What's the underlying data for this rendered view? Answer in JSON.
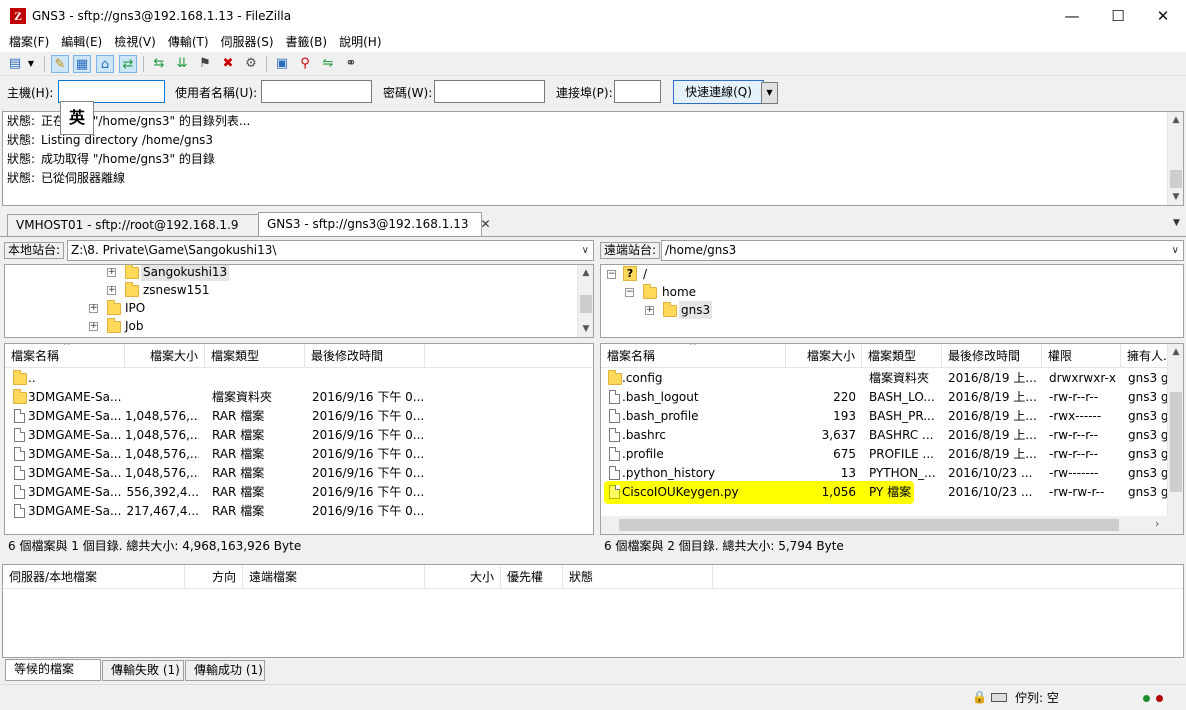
{
  "window": {
    "logo": "Z",
    "title": "GNS3 - sftp://gns3@192.168.1.13 - FileZilla",
    "minimize": "—",
    "maximize": "☐",
    "close": "✕"
  },
  "menu": [
    "檔案(F)",
    "編輯(E)",
    "檢視(V)",
    "傳輸(T)",
    "伺服器(S)",
    "書籤(B)",
    "說明(H)"
  ],
  "toolbar_icons": [
    "site-manager-icon",
    "dropdown-icon",
    "message-log-icon",
    "local-tree-icon",
    "remote-tree-icon",
    "transfer-queue-icon",
    "refresh-icon",
    "process-queue-icon",
    "cancel-icon",
    "disconnect-icon",
    "reconnect-icon",
    "filter-icon",
    "compare-icon",
    "sync-browse-icon",
    "search-icon"
  ],
  "quickconnect": {
    "host_label": "主機(H):",
    "user_label": "使用者名稱(U):",
    "pass_label": "密碼(W):",
    "port_label": "連接埠(P):",
    "button": "快速連線(Q)",
    "host_value": "",
    "user_value": "",
    "pass_value": "",
    "port_value": ""
  },
  "ime": "英",
  "log": [
    {
      "label": "狀態:",
      "text": "正在讀取 \"/home/gns3\" 的目錄列表..."
    },
    {
      "label": "狀態:",
      "text": "Listing directory /home/gns3"
    },
    {
      "label": "狀態:",
      "text": "成功取得 \"/home/gns3\" 的目錄"
    },
    {
      "label": "狀態:",
      "text": "已從伺服器離線"
    }
  ],
  "tabs": [
    {
      "label": "VMHOST01 - sftp://root@192.168.1.9",
      "active": false
    },
    {
      "label": "GNS3 - sftp://gns3@192.168.1.13",
      "active": true,
      "close": "✕"
    }
  ],
  "local": {
    "site_label": "本地站台:",
    "path": "Z:\\8. Private\\Game\\Sangokushi13\\",
    "tree": [
      {
        "label": "Sangokushi13",
        "selected": true
      },
      {
        "label": "zsnesw151",
        "selected": false
      },
      {
        "label": "IPO",
        "selected": false
      },
      {
        "label": "Job",
        "selected": false
      }
    ],
    "columns": [
      "檔案名稱",
      "檔案大小",
      "檔案類型",
      "最後修改時間"
    ],
    "rows": [
      {
        "name": "..",
        "size": "",
        "type": "",
        "modified": "",
        "icon": "folder"
      },
      {
        "name": "3DMGAME-Sa...",
        "size": "",
        "type": "檔案資料夾",
        "modified": "2016/9/16 下午 0...",
        "icon": "folder"
      },
      {
        "name": "3DMGAME-Sa...",
        "size": "1,048,576,...",
        "type": "RAR 檔案",
        "modified": "2016/9/16 下午 0...",
        "icon": "file"
      },
      {
        "name": "3DMGAME-Sa...",
        "size": "1,048,576,...",
        "type": "RAR 檔案",
        "modified": "2016/9/16 下午 0...",
        "icon": "file"
      },
      {
        "name": "3DMGAME-Sa...",
        "size": "1,048,576,...",
        "type": "RAR 檔案",
        "modified": "2016/9/16 下午 0...",
        "icon": "file"
      },
      {
        "name": "3DMGAME-Sa...",
        "size": "1,048,576,...",
        "type": "RAR 檔案",
        "modified": "2016/9/16 下午 0...",
        "icon": "file"
      },
      {
        "name": "3DMGAME-Sa...",
        "size": "556,392,4...",
        "type": "RAR 檔案",
        "modified": "2016/9/16 下午 0...",
        "icon": "file"
      },
      {
        "name": "3DMGAME-Sa...",
        "size": "217,467,4...",
        "type": "RAR 檔案",
        "modified": "2016/9/16 下午 0...",
        "icon": "file"
      }
    ],
    "status": "6 個檔案與 1 個目錄. 總共大小: 4,968,163,926 Byte"
  },
  "remote": {
    "site_label": "遠端站台:",
    "path": "/home/gns3",
    "tree": [
      {
        "label": "/",
        "marker": "?"
      },
      {
        "label": "home"
      },
      {
        "label": "gns3",
        "selected": true
      }
    ],
    "columns": [
      "檔案名稱",
      "檔案大小",
      "檔案類型",
      "最後修改時間",
      "權限",
      "擁有人..."
    ],
    "rows": [
      {
        "name": ".config",
        "size": "",
        "type": "檔案資料夾",
        "modified": "2016/8/19 上...",
        "perm": "drwxrwxr-x",
        "owner": "gns3 g",
        "icon": "folder",
        "highlight": false
      },
      {
        "name": ".bash_logout",
        "size": "220",
        "type": "BASH_LO...",
        "modified": "2016/8/19 上...",
        "perm": "-rw-r--r--",
        "owner": "gns3 g",
        "icon": "file",
        "highlight": false
      },
      {
        "name": ".bash_profile",
        "size": "193",
        "type": "BASH_PR...",
        "modified": "2016/8/19 上...",
        "perm": "-rwx------",
        "owner": "gns3 g",
        "icon": "file",
        "highlight": false
      },
      {
        "name": ".bashrc",
        "size": "3,637",
        "type": "BASHRC ...",
        "modified": "2016/8/19 上...",
        "perm": "-rw-r--r--",
        "owner": "gns3 g",
        "icon": "file",
        "highlight": false
      },
      {
        "name": ".profile",
        "size": "675",
        "type": "PROFILE ...",
        "modified": "2016/8/19 上...",
        "perm": "-rw-r--r--",
        "owner": "gns3 g",
        "icon": "file",
        "highlight": false
      },
      {
        "name": ".python_history",
        "size": "13",
        "type": "PYTHON_...",
        "modified": "2016/10/23 ...",
        "perm": "-rw-------",
        "owner": "gns3 g",
        "icon": "file",
        "highlight": false
      },
      {
        "name": "CiscoIOUKeygen.py",
        "size": "1,056",
        "type": "PY 檔案",
        "modified": "2016/10/23 ...",
        "perm": "-rw-rw-r--",
        "owner": "gns3 g",
        "icon": "file",
        "highlight": true
      }
    ],
    "status": "6 個檔案與 2 個目錄. 總共大小: 5,794 Byte"
  },
  "queue": {
    "columns": [
      "伺服器/本地檔案",
      "方向",
      "遠端檔案",
      "大小",
      "優先權",
      "狀態"
    ],
    "tabs": [
      "等候的檔案",
      "傳輸失敗 (1)",
      "傳輸成功 (1)"
    ]
  },
  "statusbar": {
    "queue_label": "佇列: 空"
  }
}
